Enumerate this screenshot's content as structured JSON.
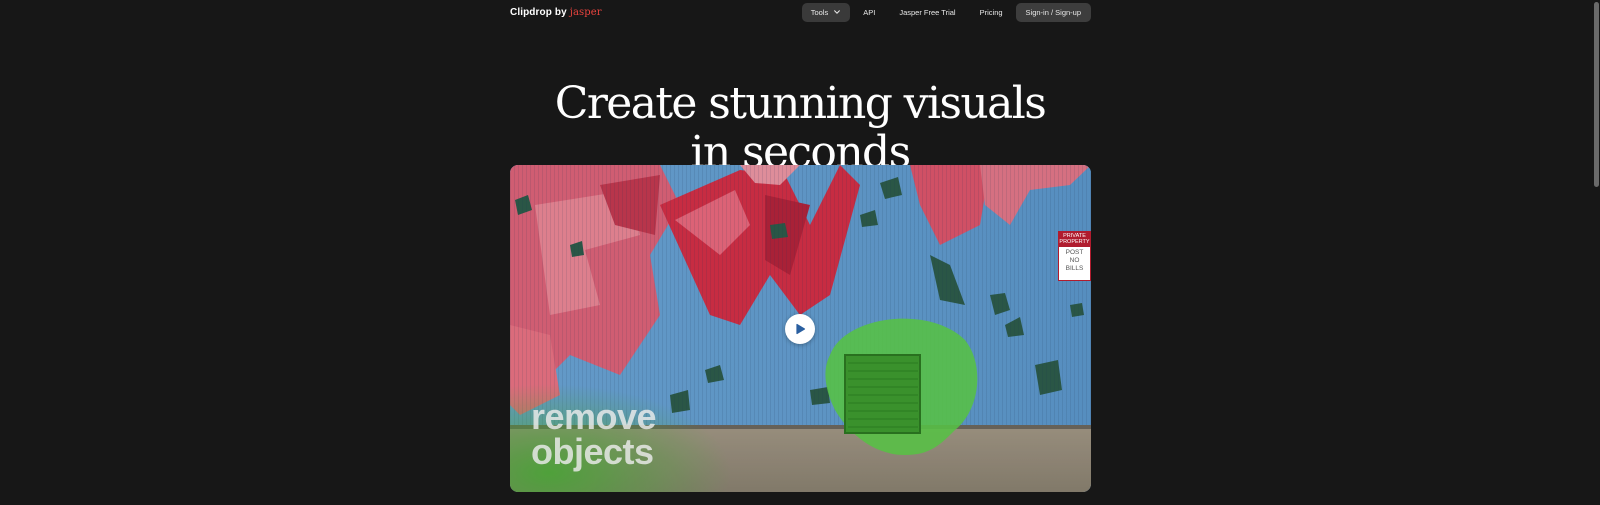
{
  "header": {
    "logo": {
      "brand": "Clipdrop",
      "by": "by",
      "partner": "jasper"
    },
    "nav": {
      "tools_label": "Tools",
      "api_label": "API",
      "trial_label": "Jasper Free Trial",
      "pricing_label": "Pricing",
      "signin_label": "Sign-in / Sign-up"
    }
  },
  "hero": {
    "title_line1": "Create stunning visuals",
    "title_line2": "in seconds"
  },
  "video": {
    "caption_line1": "remove",
    "caption_line2": "objects",
    "sign": {
      "line1": "PRIVATE",
      "line2": "PROPERTY",
      "line3": "POST",
      "line4": "NO",
      "line5": "BILLS"
    }
  },
  "colors": {
    "background": "#171717",
    "accent_jasper": "#e8433e",
    "button_bg": "#3a3a3a",
    "mask_green": "#5fd14b"
  },
  "icons": {
    "tools_dropdown": "chevron-down-icon",
    "video_play": "play-icon"
  }
}
